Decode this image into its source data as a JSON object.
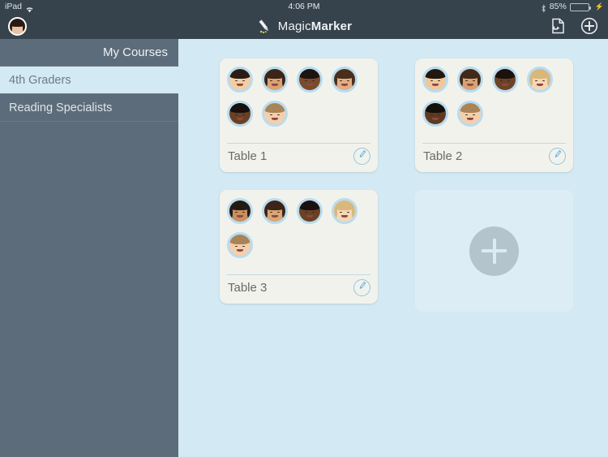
{
  "status_bar": {
    "device": "iPad",
    "wifi_icon": "wifi-icon",
    "time": "4:06 PM",
    "bluetooth_icon": "bluetooth-icon",
    "battery_percent": "85%",
    "battery_icon": "battery-charging-icon",
    "battery_level": 85,
    "battery_color": "#4cd35f"
  },
  "navbar": {
    "avatar_name": "teacher-avatar",
    "title_light": "Magic",
    "title_bold": "Marker",
    "marker_icon": "marker-pen-icon",
    "export_icon": "export-document-icon",
    "add_icon": "add-circle-icon",
    "background": "#36424c"
  },
  "sidebar": {
    "header": "My Courses",
    "background": "#5c6c7a",
    "selected_background": "#d3e9f3",
    "items": [
      {
        "label": "4th Graders",
        "selected": true
      },
      {
        "label": "Reading Specialists",
        "selected": false
      }
    ]
  },
  "content": {
    "background": "#d3e9f3",
    "card_background": "#f2f2ec",
    "avatar_ring_color": "#b8dcef",
    "add_card": {
      "name": "add-table-card",
      "icon": "plus-icon"
    },
    "tables": [
      {
        "label": "Table 1",
        "edit_icon": "pencil-icon",
        "students": [
          {
            "hair": "#2b1d16",
            "skin": "#f3cda4",
            "style": "short"
          },
          {
            "hair": "#3b2418",
            "skin": "#d9a373",
            "style": "long"
          },
          {
            "hair": "#1c1410",
            "skin": "#7a4a2c",
            "style": "short"
          },
          {
            "hair": "#4a2e1c",
            "skin": "#e2ae84",
            "style": "long"
          },
          {
            "hair": "#17100c",
            "skin": "#6b4024",
            "style": "short"
          },
          {
            "hair": "#a98456",
            "skin": "#f4cfae",
            "style": "short"
          }
        ]
      },
      {
        "label": "Table 2",
        "edit_icon": "pencil-icon",
        "students": [
          {
            "hair": "#221610",
            "skin": "#f0c79c",
            "style": "short"
          },
          {
            "hair": "#43291a",
            "skin": "#d8a274",
            "style": "long"
          },
          {
            "hair": "#1b120d",
            "skin": "#6d4225",
            "style": "short"
          },
          {
            "hair": "#d8b77a",
            "skin": "#f6d6b4",
            "style": "long"
          },
          {
            "hair": "#150f0b",
            "skin": "#5f3a20",
            "style": "short"
          },
          {
            "hair": "#a98456",
            "skin": "#f4cfae",
            "style": "short"
          }
        ]
      },
      {
        "label": "Table 3",
        "edit_icon": "pencil-icon",
        "students": [
          {
            "hair": "#241a14",
            "skin": "#c98f5f",
            "style": "long"
          },
          {
            "hair": "#3c2418",
            "skin": "#d9a676",
            "style": "long"
          },
          {
            "hair": "#191110",
            "skin": "#6b4125",
            "style": "short"
          },
          {
            "hair": "#d9b87c",
            "skin": "#f6d7b6",
            "style": "long"
          },
          {
            "hair": "#a98456",
            "skin": "#f4cfae",
            "style": "short"
          }
        ]
      }
    ]
  }
}
